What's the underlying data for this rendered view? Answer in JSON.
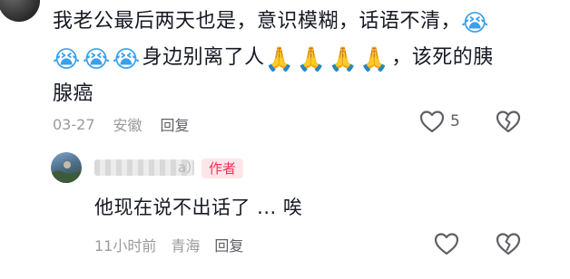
{
  "comment1": {
    "text_line1": "我老公最后两天也是，意识模糊，话语不清，",
    "text_line2_after_emojis": "身边别离了人",
    "text_line2_tail": "，该死的胰",
    "text_line3": "腺癌",
    "emoji_cry": "😭",
    "emoji_pray": "🙏",
    "date": "03-27",
    "location": "安徽",
    "reply_label": "回复",
    "like_count": "5"
  },
  "comment2": {
    "username_tail": "a）",
    "badge": "作者",
    "text": "他现在说不出话了  ... 唉",
    "time": "11小时前",
    "location": "青海",
    "reply_label": "回复"
  },
  "colors": {
    "accent": "#fe2c55",
    "badge_bg": "#fde6ea",
    "meta_gray": "#9a9a9a",
    "text": "#161823"
  }
}
